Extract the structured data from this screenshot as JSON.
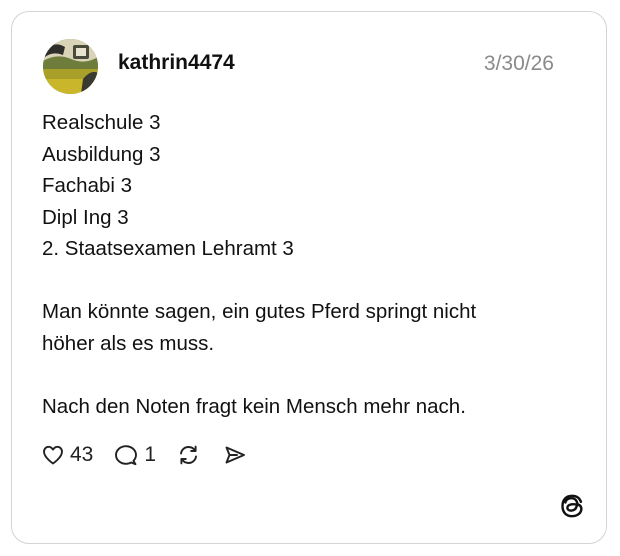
{
  "post": {
    "username": "kathrin4474",
    "date": "3/30/26",
    "lines": [
      "Realschule 3",
      "Ausbildung 3",
      "Fachabi 3",
      "Dipl Ing 3",
      "2. Staatsexamen Lehramt 3"
    ],
    "paragraph2_lines": [
      "Man könnte sagen, ein gutes Pferd springt nicht",
      "höher als es muss."
    ],
    "paragraph3_lines": [
      "Nach den Noten fragt kein Mensch mehr nach."
    ]
  },
  "actions": {
    "likes": "43",
    "replies": "1",
    "like_icon": "heart-icon",
    "reply_icon": "speech-bubble-icon",
    "repost_icon": "repost-icon",
    "share_icon": "send-icon"
  },
  "branding": {
    "logo_icon": "threads-logo-icon"
  },
  "colors": {
    "text": "#111111",
    "muted": "#8a8a8a",
    "border": "#d4d4d4"
  }
}
